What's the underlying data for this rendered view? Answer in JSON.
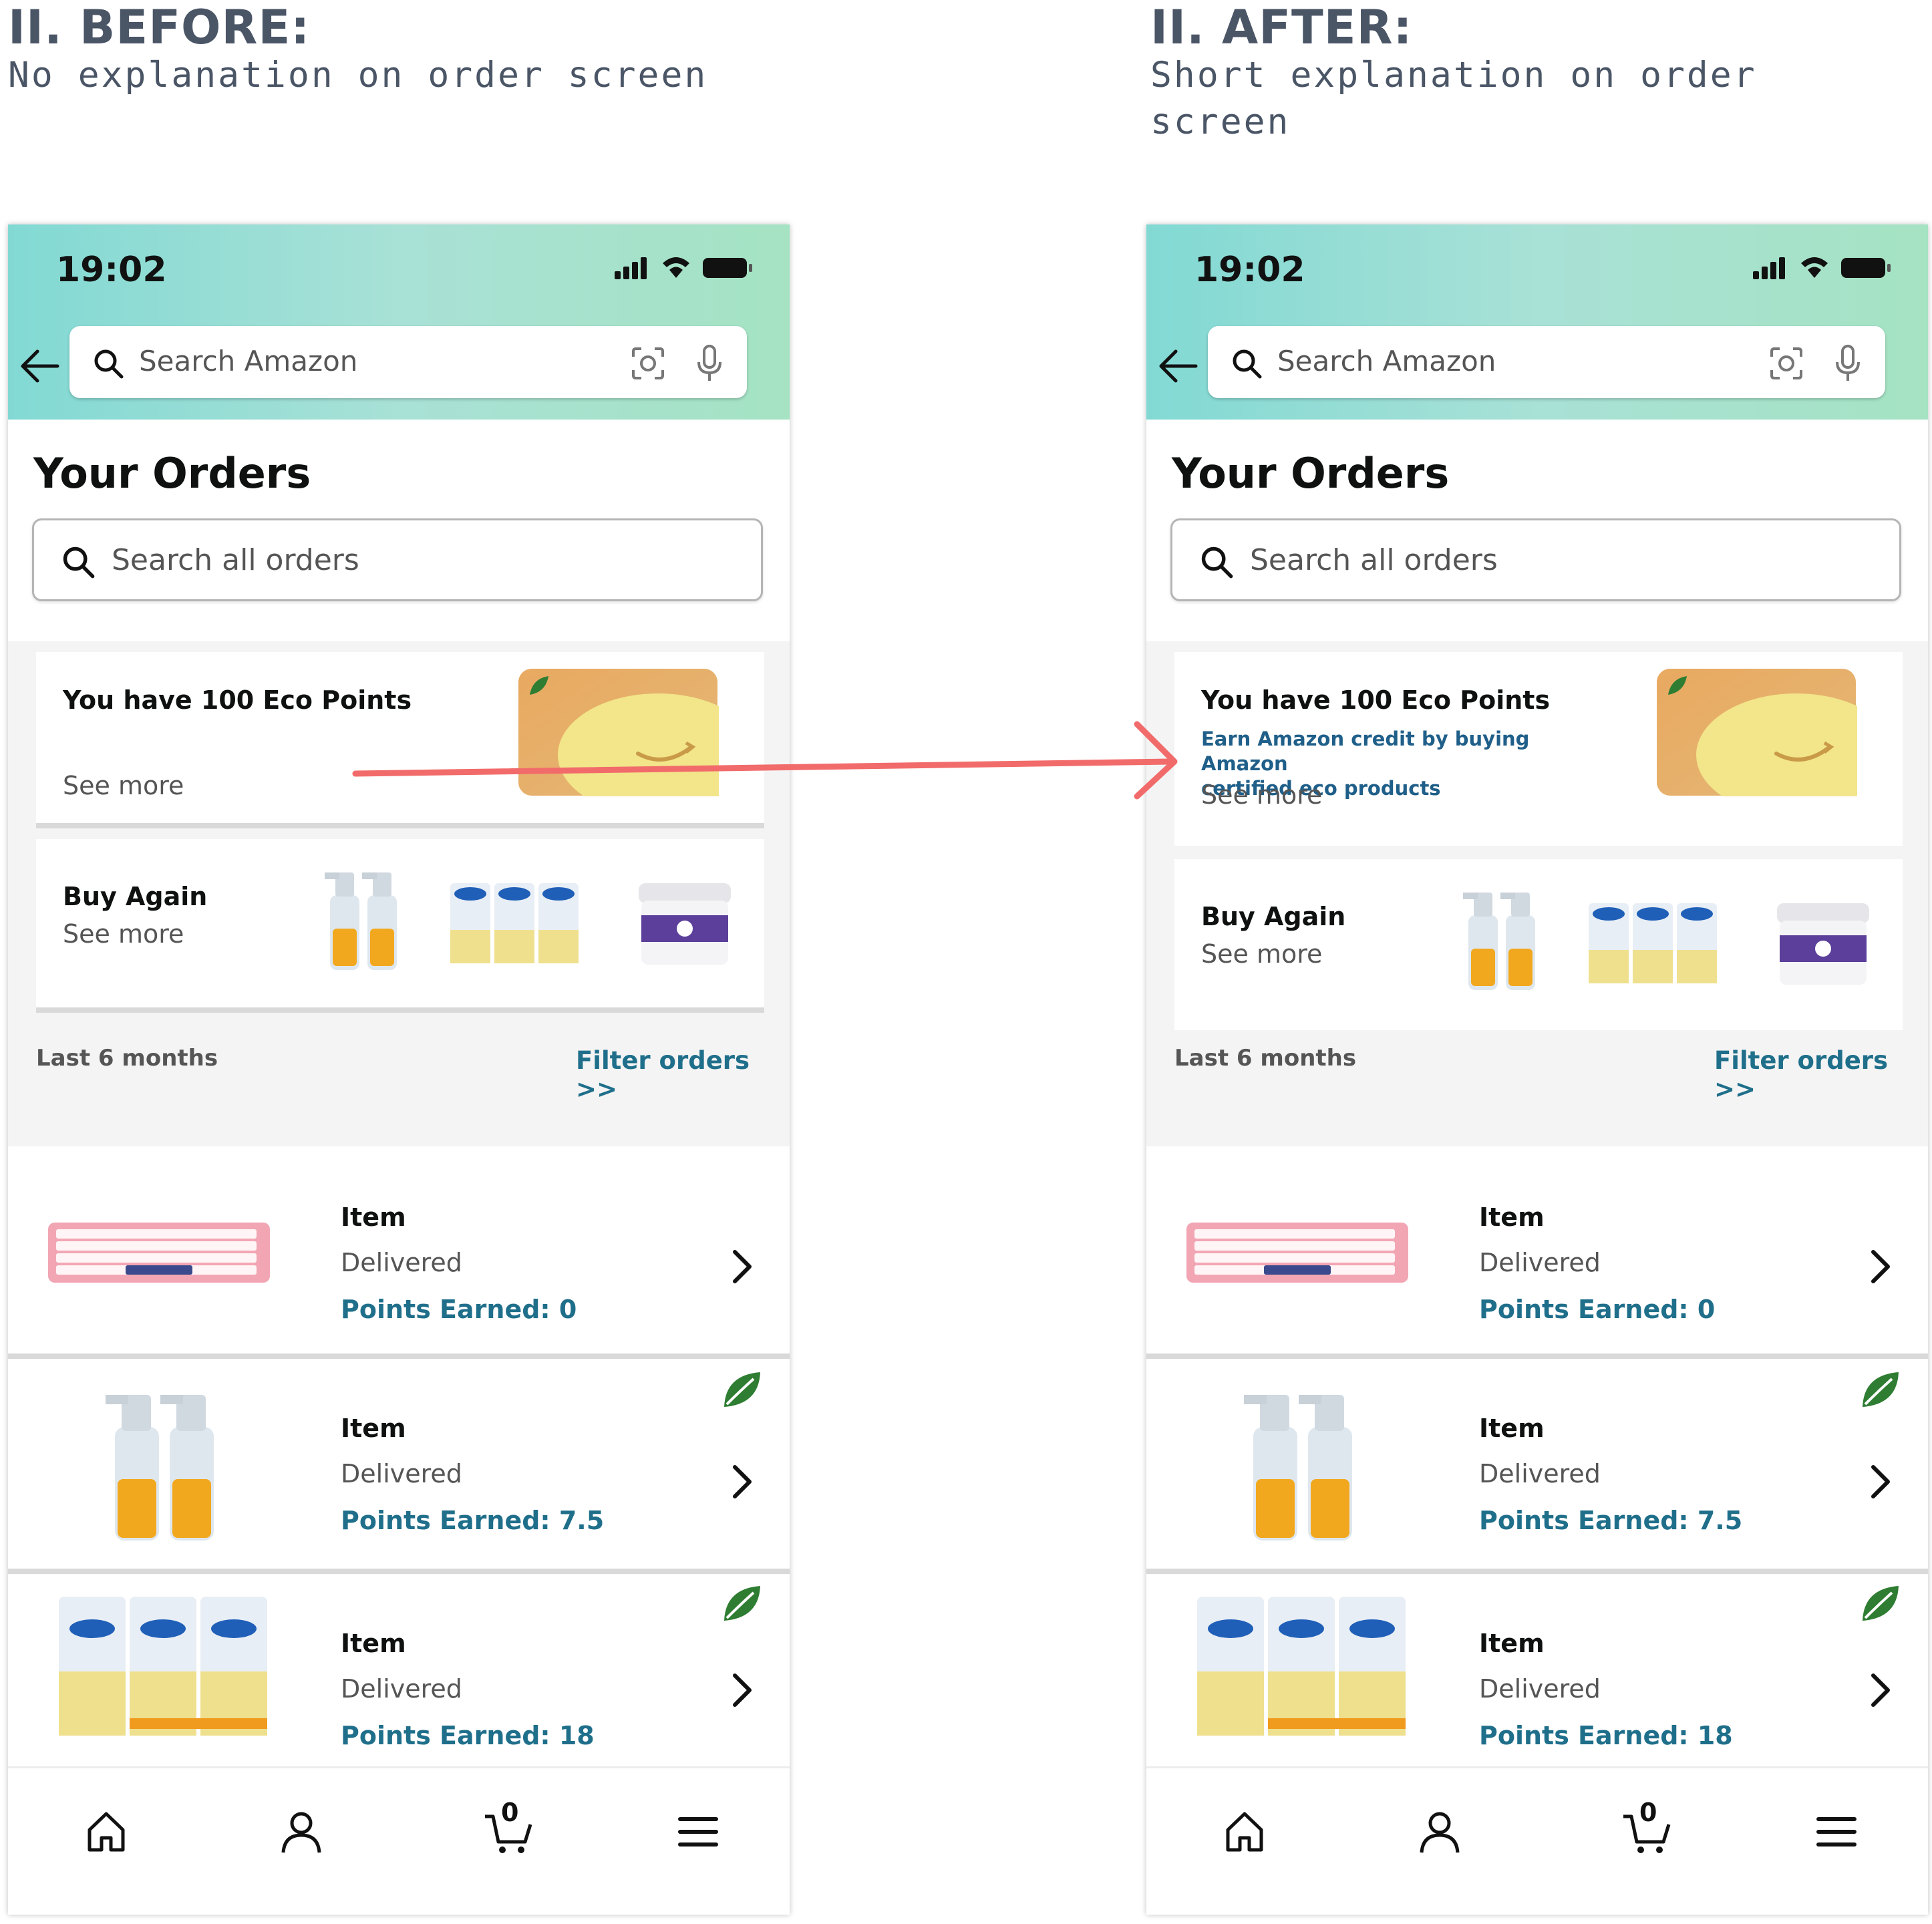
{
  "panels": {
    "before": {
      "title": "II. BEFORE:",
      "subtitle_lines": [
        "No explanation on order screen"
      ]
    },
    "after": {
      "title": "II. AFTER:",
      "subtitle_lines": [
        "Short explanation on order",
        "screen"
      ]
    }
  },
  "phone": {
    "time": "19:02",
    "search_placeholder": "Search Amazon",
    "page_title": "Your Orders",
    "orders_search_placeholder": "Search all orders",
    "eco_card": {
      "title": "You have 100 Eco Points",
      "explanation_lines": [
        "Earn Amazon credit by buying Amazon",
        "certified eco products"
      ],
      "see_more": "See more"
    },
    "buy_again": {
      "title": "Buy Again",
      "see_more": "See more"
    },
    "section_label": "Last 6 months",
    "filter_label": "Filter orders >>",
    "orders": [
      {
        "label": "Item",
        "status": "Delivered",
        "points": "Points Earned: 0",
        "eco_leaf": false,
        "image": "keyboard"
      },
      {
        "label": "Item",
        "status": "Delivered",
        "points": "Points Earned: 7.5",
        "eco_leaf": true,
        "image": "spray-bottles"
      },
      {
        "label": "Item",
        "status": "Delivered",
        "points": "Points Earned: 18",
        "eco_leaf": true,
        "image": "wipes-canisters"
      }
    ],
    "nav_icons": [
      "home-icon",
      "account-icon",
      "cart-icon",
      "menu-icon"
    ],
    "cart_count": "0"
  },
  "colors": {
    "accent_link": "#1f6f8b",
    "explanation_text": "#1f5f89",
    "annotation_arrow": "#f26b6b",
    "eco_leaf": "#2e7d32",
    "header_gradient": [
      "#82d9d4",
      "#a5e3c3"
    ]
  }
}
